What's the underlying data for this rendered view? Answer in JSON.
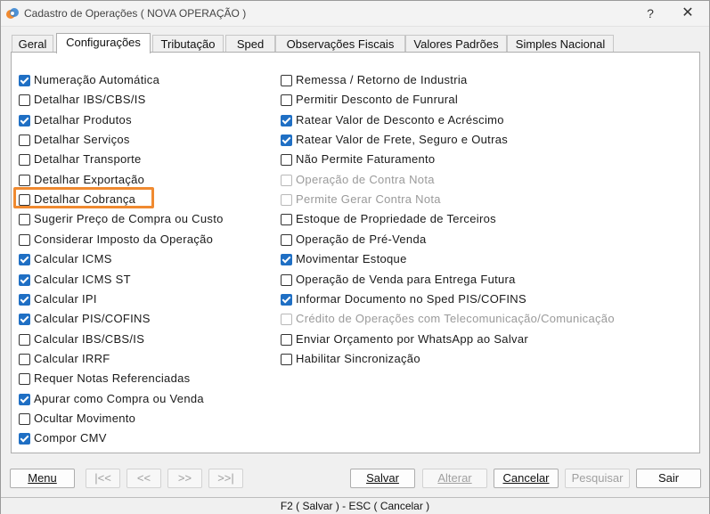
{
  "window": {
    "title": "Cadastro de Operações ( NOVA OPERAÇÃO )",
    "help_label": "?",
    "close_label": "✕"
  },
  "tabs": [
    {
      "label": "Geral",
      "active": false
    },
    {
      "label": "Configurações",
      "active": true
    },
    {
      "label": "Tributação",
      "active": false
    },
    {
      "label": "Sped",
      "active": false
    },
    {
      "label": "Observações Fiscais",
      "active": false
    },
    {
      "label": "Valores Padrões",
      "active": false
    },
    {
      "label": "Simples Nacional",
      "active": false
    }
  ],
  "left_column": [
    {
      "label": "Numeração Automática",
      "checked": true,
      "enabled": true
    },
    {
      "label": "Detalhar IBS/CBS/IS",
      "checked": false,
      "enabled": true
    },
    {
      "label": "Detalhar Produtos",
      "checked": true,
      "enabled": true
    },
    {
      "label": "Detalhar Serviços",
      "checked": false,
      "enabled": true
    },
    {
      "label": "Detalhar Transporte",
      "checked": false,
      "enabled": true
    },
    {
      "label": "Detalhar Exportação",
      "checked": false,
      "enabled": true
    },
    {
      "label": "Detalhar Cobrança",
      "checked": false,
      "enabled": true
    },
    {
      "label": "Sugerir Preço de Compra ou Custo",
      "checked": false,
      "enabled": true
    },
    {
      "label": "Considerar Imposto da Operação",
      "checked": false,
      "enabled": true
    },
    {
      "label": "Calcular ICMS",
      "checked": true,
      "enabled": true
    },
    {
      "label": "Calcular ICMS ST",
      "checked": true,
      "enabled": true
    },
    {
      "label": "Calcular IPI",
      "checked": true,
      "enabled": true
    },
    {
      "label": "Calcular PIS/COFINS",
      "checked": true,
      "enabled": true
    },
    {
      "label": "Calcular IBS/CBS/IS",
      "checked": false,
      "enabled": true
    },
    {
      "label": "Calcular IRRF",
      "checked": false,
      "enabled": true
    },
    {
      "label": "Requer Notas Referenciadas",
      "checked": false,
      "enabled": true
    },
    {
      "label": "Apurar como Compra ou Venda",
      "checked": true,
      "enabled": true
    },
    {
      "label": "Ocultar Movimento",
      "checked": false,
      "enabled": true
    },
    {
      "label": "Compor CMV",
      "checked": true,
      "enabled": true
    }
  ],
  "right_column": [
    {
      "label": "Remessa / Retorno de Industria",
      "checked": false,
      "enabled": true
    },
    {
      "label": "Permitir Desconto de Funrural",
      "checked": false,
      "enabled": true
    },
    {
      "label": "Ratear Valor de Desconto e Acréscimo",
      "checked": true,
      "enabled": true
    },
    {
      "label": "Ratear Valor de Frete, Seguro e Outras",
      "checked": true,
      "enabled": true
    },
    {
      "label": "Não Permite Faturamento",
      "checked": false,
      "enabled": true
    },
    {
      "label": "Operação de Contra Nota",
      "checked": false,
      "enabled": false
    },
    {
      "label": "Permite Gerar Contra Nota",
      "checked": false,
      "enabled": false
    },
    {
      "label": "Estoque de Propriedade de Terceiros",
      "checked": false,
      "enabled": true
    },
    {
      "label": "Operação de Pré-Venda",
      "checked": false,
      "enabled": true
    },
    {
      "label": "Movimentar Estoque",
      "checked": true,
      "enabled": true
    },
    {
      "label": "Operação de Venda para Entrega Futura",
      "checked": false,
      "enabled": true
    },
    {
      "label": "Informar Documento no Sped PIS/COFINS",
      "checked": true,
      "enabled": true
    },
    {
      "label": "Crédito de Operações com Telecomunicação/Comunicação",
      "checked": false,
      "enabled": false
    },
    {
      "label": "Enviar Orçamento por WhatsApp ao Salvar",
      "checked": false,
      "enabled": true
    },
    {
      "label": "Habilitar Sincronização",
      "checked": false,
      "enabled": true
    }
  ],
  "highlighted_option": "Detalhar Cobrança",
  "footer": {
    "menu": "Menu",
    "first": "|<<",
    "prev": "<<",
    "next": ">>",
    "last": ">>|",
    "save": "Salvar",
    "edit": "Alterar",
    "cancel": "Cancelar",
    "search": "Pesquisar",
    "exit": "Sair"
  },
  "status_bar": "F2 ( Salvar )  -  ESC ( Cancelar )",
  "colors": {
    "checkbox_checked": "#1f6fc4",
    "highlight_border": "#f08a30",
    "app_icon_orange": "#f08a30",
    "app_icon_blue": "#2f7fd0"
  }
}
